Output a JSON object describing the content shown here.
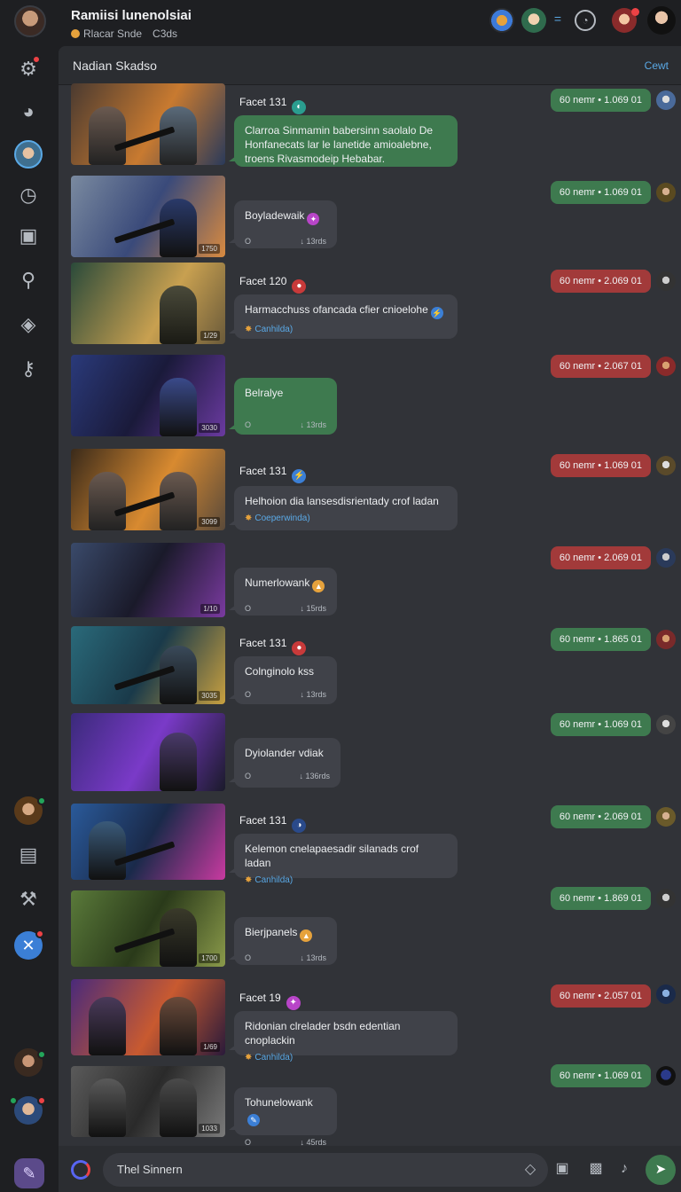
{
  "header": {
    "title": "Ramiisi lunenolsiai",
    "subtitle": "Rlacar Snde",
    "subtitle2": "C3ds"
  },
  "channel": {
    "title": "Nadian Skadso",
    "action": "Cewt"
  },
  "messages": [
    {
      "sender": "Facet 131",
      "text": "Clarroa Sinmamin babersinn saolalo De Honfanecats lar le lanetide amioalebne, troens Rivasmodeip Hebabar.",
      "bubble": "green",
      "pill": "60 nemr • 1.069 01",
      "pill_color": "green"
    },
    {
      "text": "Boyladewaik",
      "meta_left": "O",
      "meta_right": "↓ 13rds",
      "bubble": "gray",
      "pill": "60 nemr • 1.069 01",
      "pill_color": "green"
    },
    {
      "sender": "Facet 120",
      "text": "Harmacchuss ofancada cfier cnioelohe",
      "sub": "Canhilda)",
      "bubble": "gray",
      "pill": "60 nemr • 2.069 01",
      "pill_color": "red"
    },
    {
      "text": "Belralye",
      "meta_left": "O",
      "meta_right": "↓ 13rds",
      "bubble": "green",
      "pill": "60 nemr • 2.067 01",
      "pill_color": "red"
    },
    {
      "sender": "Facet 131",
      "text": "Helhoion dia lansesdisrientady crof ladan",
      "sub": "Coeperwinda)",
      "bubble": "gray",
      "pill": "60 nemr • 1.069 01",
      "pill_color": "red"
    },
    {
      "text": "Numerlowank",
      "meta_left": "O",
      "meta_right": "↓ 15rds",
      "bubble": "gray",
      "pill": "60 nemr • 2.069 01",
      "pill_color": "red"
    },
    {
      "sender": "Facet 131",
      "text": "Colnginolo kss",
      "meta_left": "O",
      "meta_right": "↓ 13rds",
      "bubble": "gray",
      "pill": "60 nemr • 1.865 01",
      "pill_color": "green"
    },
    {
      "text": "Dyiolander vdiak",
      "meta_left": "O",
      "meta_right": "↓ 136rds",
      "bubble": "gray",
      "pill": "60 nemr • 1.069 01",
      "pill_color": "green"
    },
    {
      "sender": "Facet 131",
      "text": "Kelemon cnelapaesadir silanads crof ladan",
      "sub": "Canhilda)",
      "bubble": "gray",
      "pill": "60 nemr • 2.069 01",
      "pill_color": "green"
    },
    {
      "text": "Bierjpanels",
      "meta_left": "O",
      "meta_right": "↓ 13rds",
      "bubble": "gray",
      "pill": "60 nemr • 1.869 01",
      "pill_color": "green"
    },
    {
      "sender": "Facet 19",
      "text": "Ridonian clrelader bsdn edentian cnoplackin",
      "sub": "Canhilda)",
      "bubble": "gray",
      "pill": "60 nemr • 2.057 01",
      "pill_color": "red"
    },
    {
      "text": "Tohunelowank",
      "meta_left": "O",
      "meta_right": "↓ 45rds",
      "bubble": "gray",
      "pill": "60 nemr • 1.069 01",
      "pill_color": "green"
    }
  ],
  "composer": {
    "value": "Thel Sinnern"
  }
}
